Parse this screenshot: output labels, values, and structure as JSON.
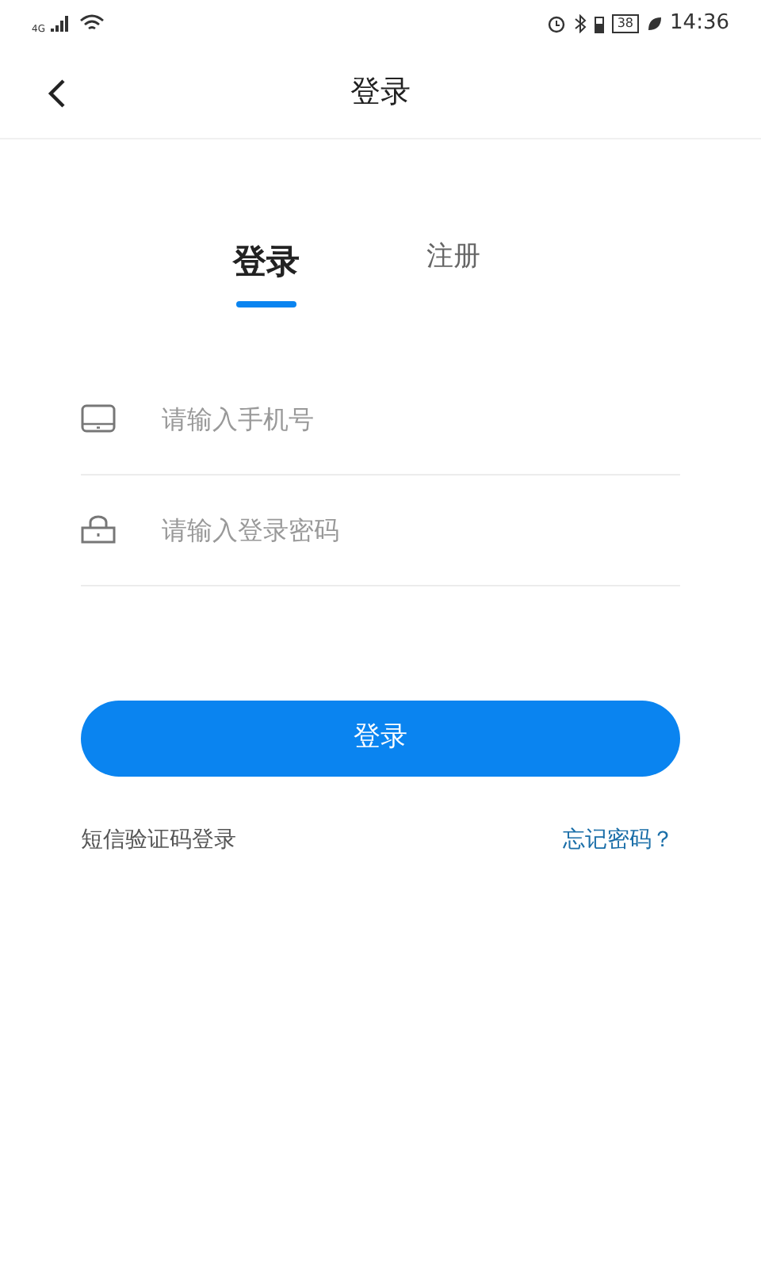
{
  "status_bar": {
    "network": "4G",
    "battery": "38",
    "time": "14:36"
  },
  "header": {
    "title": "登录"
  },
  "tabs": [
    {
      "label": "登录",
      "selected": true
    },
    {
      "label": "注册",
      "selected": false
    }
  ],
  "fields": [
    {
      "kind": "phone",
      "placeholder": "请输入手机号"
    },
    {
      "kind": "password",
      "placeholder": "请输入登录密码"
    }
  ],
  "submit": "登录",
  "links": {
    "sms_login": "短信验证码登录",
    "forgot": "忘记密码？"
  }
}
